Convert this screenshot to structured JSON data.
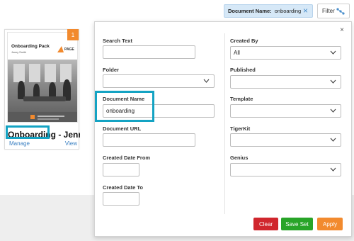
{
  "active_filter": {
    "key": "Document Name:",
    "value": "onboarding"
  },
  "filter_button": {
    "label": "Filter"
  },
  "card": {
    "badge": "1",
    "thumbnail": {
      "title": "Onboarding Pack",
      "author": "Jenny Smith",
      "logo_text": "PAGE"
    },
    "title": "Onboarding - Jenny ...",
    "manage_label": "Manage",
    "view_label": "View"
  },
  "panel": {
    "close": "×",
    "left": {
      "search_text": {
        "label": "Search Text",
        "value": ""
      },
      "folder": {
        "label": "Folder",
        "value": ""
      },
      "document_name": {
        "label": "Document Name",
        "value": "onboarding"
      },
      "document_url": {
        "label": "Document URL",
        "value": ""
      },
      "created_from": {
        "label": "Created Date From",
        "value": ""
      },
      "created_to": {
        "label": "Created Date To",
        "value": ""
      }
    },
    "right": {
      "created_by": {
        "label": "Created By",
        "value": "All"
      },
      "published": {
        "label": "Published",
        "value": ""
      },
      "template": {
        "label": "Template",
        "value": ""
      },
      "tigerkit": {
        "label": "TigerKit",
        "value": ""
      },
      "genius": {
        "label": "Genius",
        "value": ""
      }
    },
    "buttons": {
      "clear": "Clear",
      "save_set": "Save Set",
      "apply": "Apply"
    }
  },
  "colors": {
    "accent": "#f28a2e",
    "highlight": "#14a3c3",
    "clear": "#d0262d",
    "save": "#28a428",
    "chip_bg": "#d6e8f7",
    "link": "#3b80c2"
  }
}
